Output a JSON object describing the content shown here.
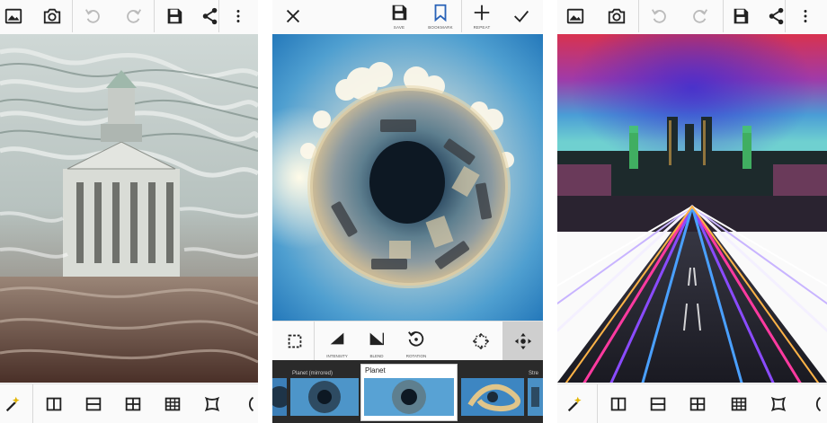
{
  "screens": [
    {
      "toolbar": {
        "icons": [
          "image-icon",
          "camera-icon",
          "undo-icon",
          "redo-icon",
          "save-icon",
          "share-icon",
          "more-vert-icon"
        ]
      },
      "bottombar": {
        "icons": [
          "magic-wand-icon",
          "split-vertical-icon",
          "split-horizontal-icon",
          "grid-2x2-icon",
          "grid-3x3-icon",
          "perspective-icon",
          "curve-icon"
        ]
      }
    },
    {
      "toolbar": {
        "close_icon": "close-icon",
        "save_label": "SAVE",
        "bookmark_label": "BOOKMARK",
        "repeat_label": "REPEAT",
        "confirm_icon": "check-icon"
      },
      "tools": [
        {
          "icon": "crop-dashed-icon",
          "label": ""
        },
        {
          "icon": "intensity-icon",
          "label": "INTENSITY"
        },
        {
          "icon": "blend-icon",
          "label": "BLEND"
        },
        {
          "icon": "rotation-icon",
          "label": "ROTATION"
        },
        {
          "icon": "move-dashed-icon",
          "label": ""
        },
        {
          "icon": "move-icon",
          "label": ""
        }
      ],
      "filmstrip": {
        "items": [
          {
            "label": ""
          },
          {
            "label": "Planet (mirrored)"
          },
          {
            "label": "Planet",
            "selected": true
          },
          {
            "label": ""
          },
          {
            "label": "Stre"
          }
        ]
      }
    },
    {
      "toolbar": {
        "icons": [
          "image-icon",
          "camera-icon",
          "undo-icon",
          "redo-icon",
          "save-icon",
          "share-icon",
          "more-vert-icon"
        ]
      },
      "bottombar": {
        "icons": [
          "magic-wand-icon",
          "split-vertical-icon",
          "split-horizontal-icon",
          "grid-2x2-icon",
          "grid-3x3-icon",
          "perspective-icon",
          "curve-icon"
        ]
      }
    }
  ],
  "colors": {
    "accent_blue": "#2a63b8",
    "toolbar_bg": "#fafafa",
    "icon_dark": "#222222",
    "icon_disabled": "#bbbbbb"
  }
}
